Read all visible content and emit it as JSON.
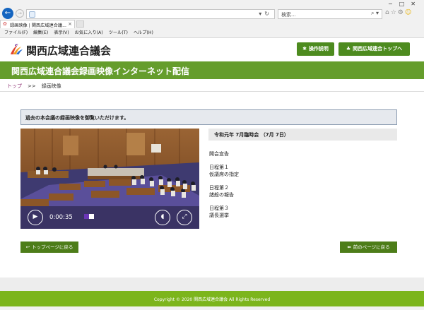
{
  "browser": {
    "search_placeholder": "検索...",
    "tab_title": "録画映像 | 関西広域連合議...",
    "menu": [
      "ファイル(F)",
      "編集(E)",
      "表示(V)",
      "お気に入り(A)",
      "ツール(T)",
      "ヘルプ(H)"
    ]
  },
  "header": {
    "site_name": "関西広域連合議会",
    "buttons": [
      "操作説明",
      "関西広域連合トップへ"
    ]
  },
  "banner": {
    "title": "関西広域連合議会録画映像インターネット配信"
  },
  "breadcrumb": {
    "home": "トップ",
    "separator": ">>",
    "current": "録画映像"
  },
  "notice": "過去の本会議の録画映像を御覧いただけます。",
  "player": {
    "time": "0:00:35",
    "progress_fraction": 0.5
  },
  "session": {
    "title": "令和元年 7月臨時会 （7月 7日）",
    "agenda": [
      {
        "lines": [
          "開会宣告"
        ]
      },
      {
        "lines": [
          "日程第１",
          "仮議席の指定"
        ]
      },
      {
        "lines": [
          "日程第２",
          "諸般の報告"
        ]
      },
      {
        "lines": [
          "日程第３",
          "議長選挙"
        ]
      }
    ]
  },
  "nav": {
    "back_top": "トップページに戻る",
    "back_prev": "前のページに戻る"
  },
  "footer": {
    "copyright": "Copyright © 2020 関西広域連合議会 All Rights Reserved"
  },
  "colors": {
    "brand_green": "#659d2c",
    "button_green": "#4d7d19",
    "footer_green": "#7cb51c"
  }
}
